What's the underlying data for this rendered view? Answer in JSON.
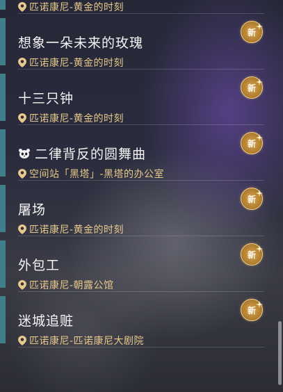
{
  "list": {
    "partial_item": {
      "location": "匹诺康尼-黄金的时刻"
    },
    "items": [
      {
        "title": "想象一朵未来的玫瑰",
        "location": "匹诺康尼-黄金的时刻",
        "badge": "新",
        "title_icon": ""
      },
      {
        "title": "十三只钟",
        "location": "匹诺康尼-黄金的时刻",
        "badge": "新",
        "title_icon": ""
      },
      {
        "title": "二律背反的圆舞曲",
        "location": "空间站「黑塔」-黑塔的办公室",
        "badge": "新",
        "title_icon": "panda-icon"
      },
      {
        "title": "屠场",
        "location": "匹诺康尼-黄金的时刻",
        "badge": "新",
        "title_icon": ""
      },
      {
        "title": "外包工",
        "location": "匹诺康尼-朝露公馆",
        "badge": "新",
        "title_icon": ""
      },
      {
        "title": "迷城追赃",
        "location": "匹诺康尼-匹诺康尼大剧院",
        "badge": "新",
        "title_icon": ""
      }
    ]
  },
  "colors": {
    "accent_bar": "#3f7f8c",
    "location_text": "#e7c88c",
    "badge_gold": "#b2802f"
  }
}
